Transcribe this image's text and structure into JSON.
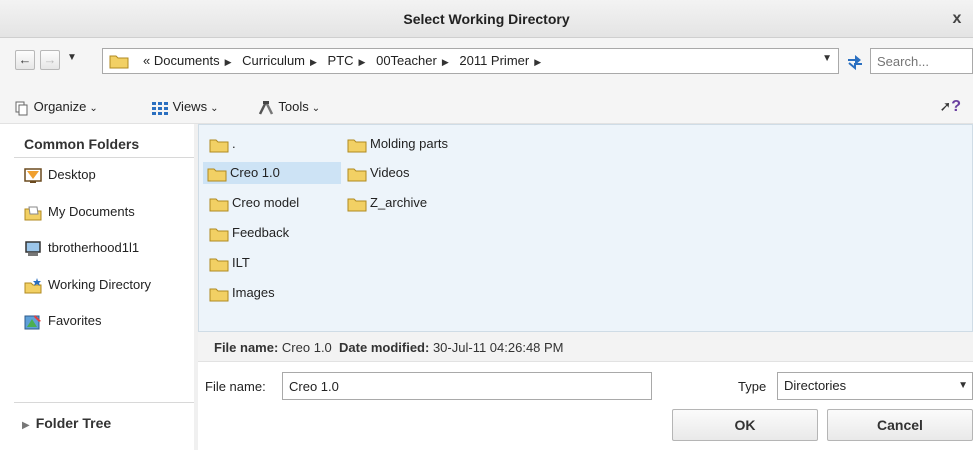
{
  "window": {
    "title": "Select Working Directory",
    "close_glyph": "x"
  },
  "address": {
    "overflow": "«",
    "crumbs": [
      "Documents",
      "Curriculum",
      "PTC",
      "00Teacher",
      "2011 Primer"
    ],
    "search_placeholder": "Search..."
  },
  "toolbar": {
    "organize": "Organize",
    "views": "Views",
    "tools": "Tools",
    "help_glyph": "?"
  },
  "sidebar": {
    "header": "Common Folders",
    "items": [
      {
        "label": "Desktop",
        "icon": "desktop-icon"
      },
      {
        "label": "My Documents",
        "icon": "my-documents-icon"
      },
      {
        "label": "tbrotherhood1l1",
        "icon": "computer-icon"
      },
      {
        "label": "Working Directory",
        "icon": "working-directory-icon"
      },
      {
        "label": "Favorites",
        "icon": "favorites-icon"
      }
    ],
    "folder_tree": "Folder Tree"
  },
  "files": [
    {
      "name": "."
    },
    {
      "name": "Creo 1.0",
      "selected": true
    },
    {
      "name": "Creo model"
    },
    {
      "name": "Feedback"
    },
    {
      "name": "ILT"
    },
    {
      "name": "Images"
    },
    {
      "name": "Molding parts"
    },
    {
      "name": "Videos"
    },
    {
      "name": "Z_archive"
    }
  ],
  "info": {
    "file_name_label": "File name:",
    "file_name_value": "Creo 1.0",
    "date_label": "Date modified:",
    "date_value": "30-Jul-11 04:26:48 PM"
  },
  "form": {
    "file_name_label": "File name:",
    "file_name_value": "Creo 1.0",
    "type_label": "Type",
    "type_value": "Directories"
  },
  "buttons": {
    "ok": "OK",
    "cancel": "Cancel"
  },
  "colors": {
    "folder": "#f2d064",
    "selection": "#cde3f5",
    "file_area": "#edf4fa"
  }
}
